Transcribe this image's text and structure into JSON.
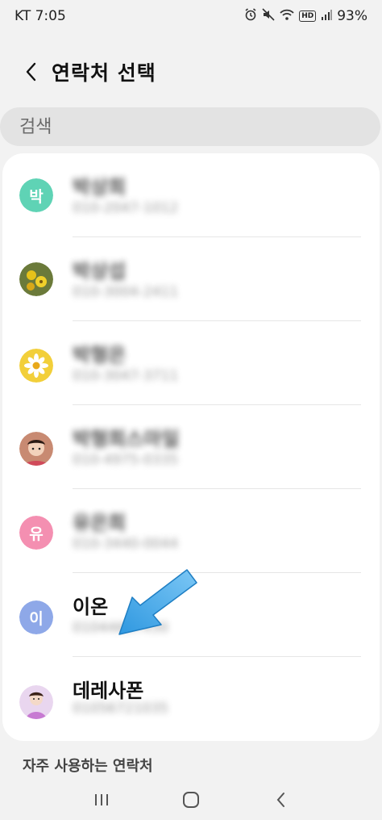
{
  "status_bar": {
    "carrier_time": "KT 7:05",
    "battery": "93%",
    "hd_label": "HD"
  },
  "header": {
    "title": "연락처 선택",
    "back_icon": "chevron-left-icon"
  },
  "search": {
    "placeholder": "검색"
  },
  "contacts": [
    {
      "avatar_text": "박",
      "avatar_color": "#5fd3b5",
      "name": "박상희",
      "phone": "010-2047-1012",
      "blurred": true
    },
    {
      "avatar_text": "",
      "avatar_color": "#7a6a3a",
      "name": "박상섭",
      "phone": "010-3004-2411",
      "blurred": true
    },
    {
      "avatar_text": "",
      "avatar_color": "#f2cf3a",
      "name": "박형은",
      "phone": "010-3047-3711",
      "blurred": true
    },
    {
      "avatar_text": "",
      "avatar_color": "#c88a72",
      "name": "박형희스마일",
      "phone": "010-4975-0335",
      "blurred": true
    },
    {
      "avatar_text": "유",
      "avatar_color": "#f48fb1",
      "name": "유은희",
      "phone": "010-3440-0044",
      "blurred": true
    },
    {
      "avatar_text": "이",
      "avatar_color": "#8ea8e8",
      "name": "이온",
      "phone": "01044697430",
      "blurred_phone": true
    },
    {
      "avatar_text": "",
      "avatar_color": "#c79ad6",
      "name": "데레사폰",
      "phone": "01056721035",
      "blurred_phone": true
    }
  ],
  "frequent_section": {
    "label": "자주 사용하는 연락처"
  },
  "colors": {
    "arrow": "#3fa7ea",
    "background": "#f2f2f2",
    "card": "#ffffff"
  }
}
